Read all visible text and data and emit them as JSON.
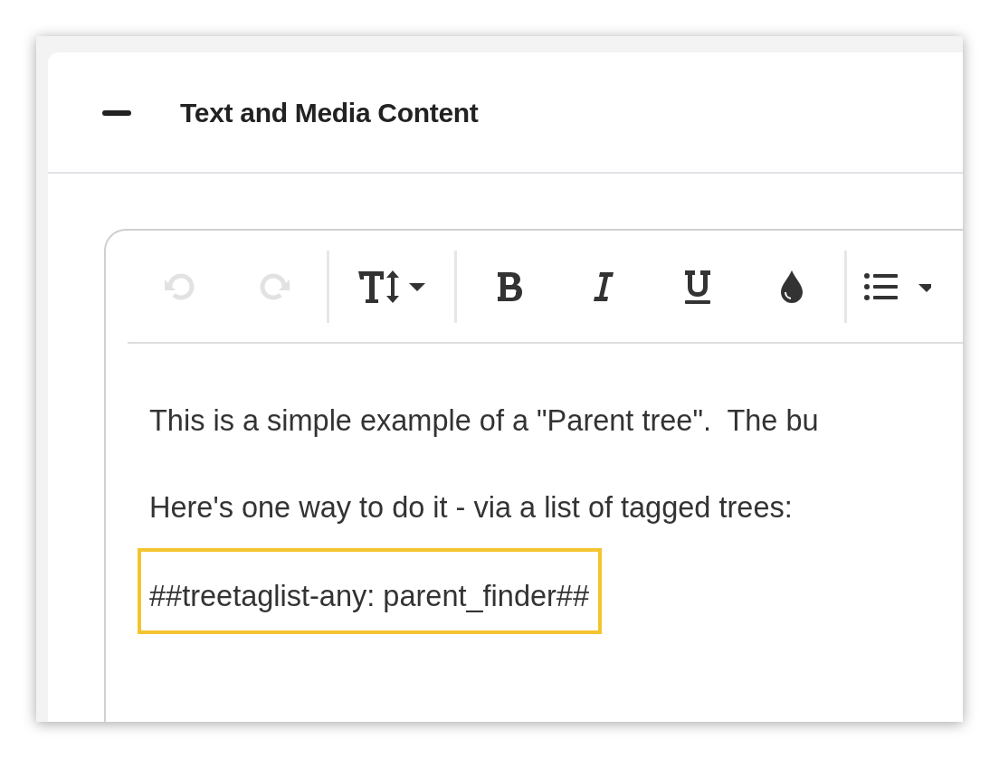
{
  "section": {
    "title": "Text and Media Content",
    "expanded": true
  },
  "editor": {
    "toolbar_groups": [
      [
        {
          "kind": "undo",
          "disabled": true
        },
        {
          "kind": "redo",
          "disabled": true
        }
      ],
      [
        {
          "kind": "text-size",
          "disabled": false
        }
      ],
      [
        {
          "kind": "bold",
          "disabled": false
        },
        {
          "kind": "italic",
          "disabled": false
        },
        {
          "kind": "underline",
          "disabled": false
        },
        {
          "kind": "color",
          "disabled": false
        }
      ],
      [
        {
          "kind": "list",
          "disabled": false
        }
      ]
    ],
    "paragraphs": [
      {
        "text": "This is a simple example of a \"Parent tree\".  The bu",
        "highlighted": false
      },
      {
        "text": "Here's one way to do it - via a list of tagged trees:",
        "highlighted": false
      },
      {
        "text": "##treetaglist-any: parent_finder##",
        "highlighted": true
      }
    ]
  }
}
